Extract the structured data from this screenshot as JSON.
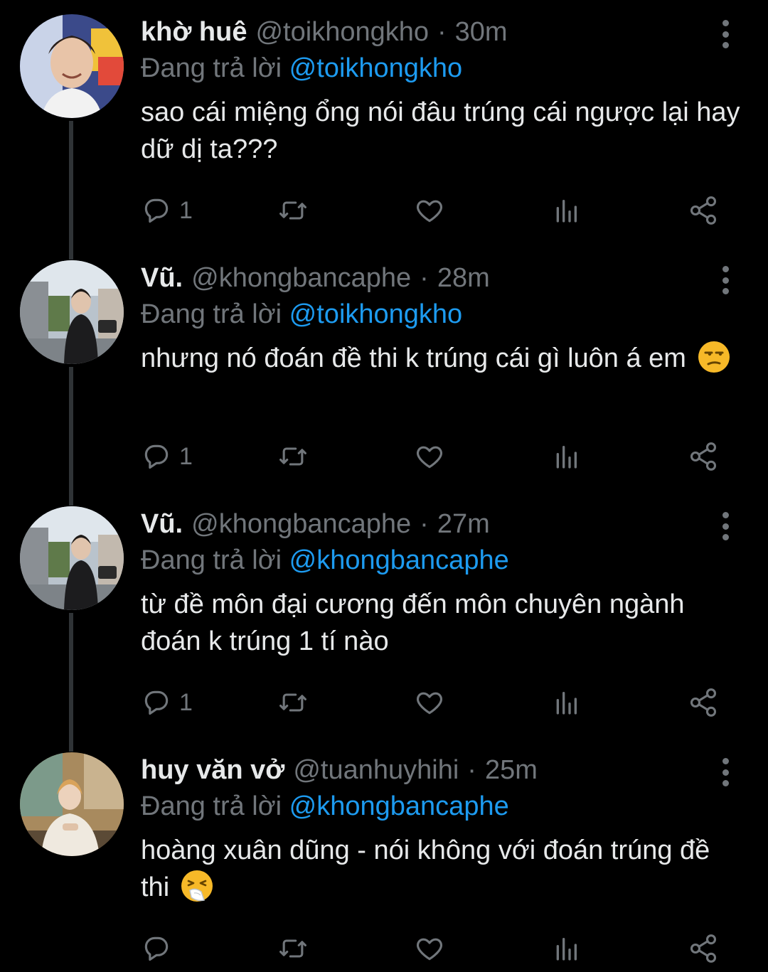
{
  "tweets": [
    {
      "name": "khờ huê",
      "handle": "@toikhongkho",
      "time": "30m",
      "replying_prefix": "Đang trả lời",
      "replying_to": "@toikhongkho",
      "text": "sao cái miệng ổng nói đâu trúng cái ngược lại hay dữ dị ta???",
      "emoji": "",
      "reply_count": "1"
    },
    {
      "name": "Vũ.",
      "handle": "@khongbancaphe",
      "time": "28m",
      "replying_prefix": "Đang trả lời",
      "replying_to": "@toikhongkho",
      "text": "nhưng nó đoán đề thi k trúng cái gì luôn á em",
      "emoji": "unamused-face",
      "reply_count": "1"
    },
    {
      "name": "Vũ.",
      "handle": "@khongbancaphe",
      "time": "27m",
      "replying_prefix": "Đang trả lời",
      "replying_to": "@khongbancaphe",
      "text": "từ đề môn đại cương đến môn chuyên ngành đoán k trúng 1 tí nào",
      "emoji": "",
      "reply_count": "1"
    },
    {
      "name": "huy văn vở",
      "handle": "@tuanhuyhihi",
      "time": "25m",
      "replying_prefix": "Đang trả lời",
      "replying_to": "@khongbancaphe",
      "text": "hoàng xuân dũng - nói không với đoán trúng đề thi",
      "emoji": "sneezing-face",
      "reply_count": ""
    }
  ],
  "icons": {
    "reply": "reply-icon",
    "retweet": "retweet-icon",
    "like": "heart-icon",
    "views": "analytics-icon",
    "share": "share-icon",
    "more": "more-vertical-icon"
  },
  "colors": {
    "background": "#000000",
    "text": "#e7e9ea",
    "secondary": "#71767b",
    "mention": "#1d9bf0",
    "thread_line": "#2f3336"
  }
}
